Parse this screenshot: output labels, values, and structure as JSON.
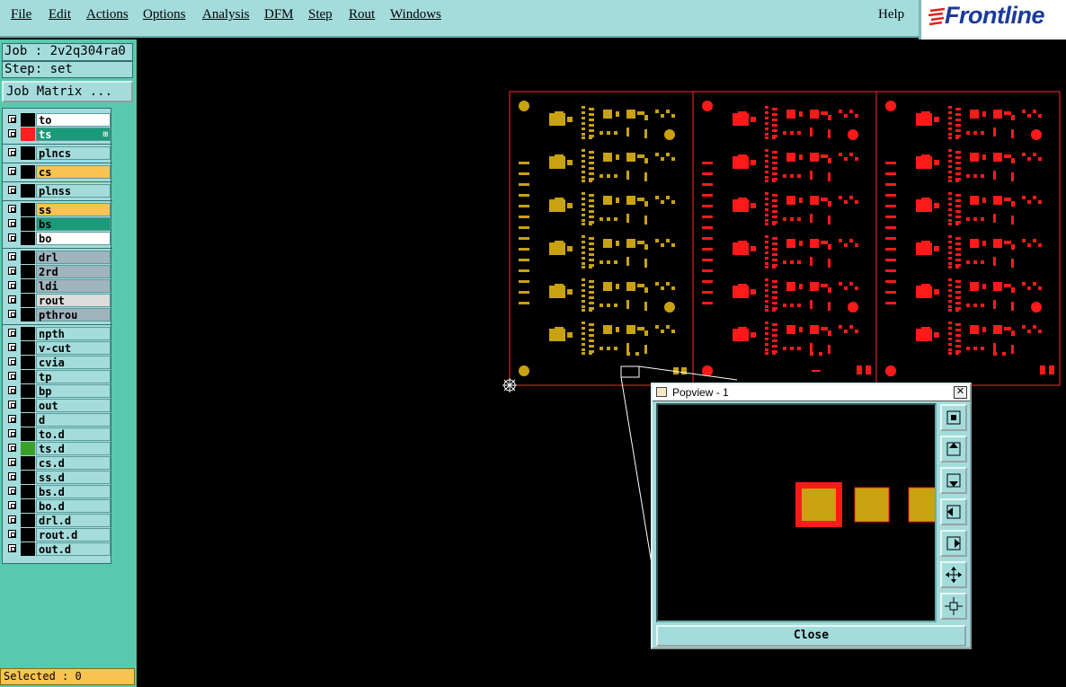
{
  "menubar": {
    "items": [
      "File",
      "Edit",
      "Actions",
      "Options",
      "Analysis",
      "DFM",
      "Step",
      "Rout",
      "Windows"
    ],
    "help": "Help"
  },
  "logo": {
    "text": "Frontline",
    "icon": "frontline-logo-icon"
  },
  "job": {
    "label": "Job : 2v2q304ra0",
    "step": "Step: set",
    "matrix_button": "Job Matrix ..."
  },
  "layers": [
    {
      "name": "to",
      "color": "#ffffff"
    },
    {
      "name": "ts",
      "color": "#1a9a78",
      "swatch": "#ff2020",
      "active": true
    },
    {
      "name": "plncs",
      "color": "#a4dcdc"
    },
    {
      "name": "cs",
      "color": "#f7c451"
    },
    {
      "name": "plnss",
      "color": "#a4dcdc"
    },
    {
      "name": "ss",
      "color": "#f7c451"
    },
    {
      "name": "bs",
      "color": "#1a9a78"
    },
    {
      "name": "bo",
      "color": "#ffffff"
    },
    {
      "name": "drl",
      "color": "#a0b4be"
    },
    {
      "name": "2rd",
      "color": "#a0b4be"
    },
    {
      "name": "ldi",
      "color": "#a0b4be"
    },
    {
      "name": "rout",
      "color": "#dcdcdc"
    },
    {
      "name": "pthrou",
      "color": "#a0b4be"
    },
    {
      "name": "npth",
      "color": "#a4dcdc"
    },
    {
      "name": "v-cut",
      "color": "#a4dcdc"
    },
    {
      "name": "cvia",
      "color": "#a4dcdc"
    },
    {
      "name": "tp",
      "color": "#a4dcdc"
    },
    {
      "name": "bp",
      "color": "#a4dcdc"
    },
    {
      "name": "out",
      "color": "#a4dcdc"
    },
    {
      "name": "d",
      "color": "#a4dcdc"
    },
    {
      "name": "to.d",
      "color": "#a4dcdc"
    },
    {
      "name": "ts.d",
      "color": "#a4dcdc",
      "swatch": "#3aa02a"
    },
    {
      "name": "cs.d",
      "color": "#a4dcdc"
    },
    {
      "name": "ss.d",
      "color": "#a4dcdc"
    },
    {
      "name": "bs.d",
      "color": "#a4dcdc"
    },
    {
      "name": "bo.d",
      "color": "#a4dcdc"
    },
    {
      "name": "drl.d",
      "color": "#a4dcdc"
    },
    {
      "name": "rout.d",
      "color": "#a4dcdc"
    },
    {
      "name": "out.d",
      "color": "#a4dcdc"
    }
  ],
  "status": {
    "selected": "Selected : 0"
  },
  "popview": {
    "title": "Popview - 1",
    "close_label": "Close",
    "tools": [
      "zoom-fit-icon",
      "pan-up-icon",
      "pan-down-icon",
      "pan-left-icon",
      "pan-right-icon",
      "zoom-in-icon",
      "zoom-out-icon"
    ]
  },
  "colors": {
    "board_outline": "#ff2a2a",
    "copper_gold": "#c9a212",
    "copper_red": "#ff1a1a",
    "panel_bg": "#a4dcdc",
    "panel_green": "#58c9ad"
  }
}
